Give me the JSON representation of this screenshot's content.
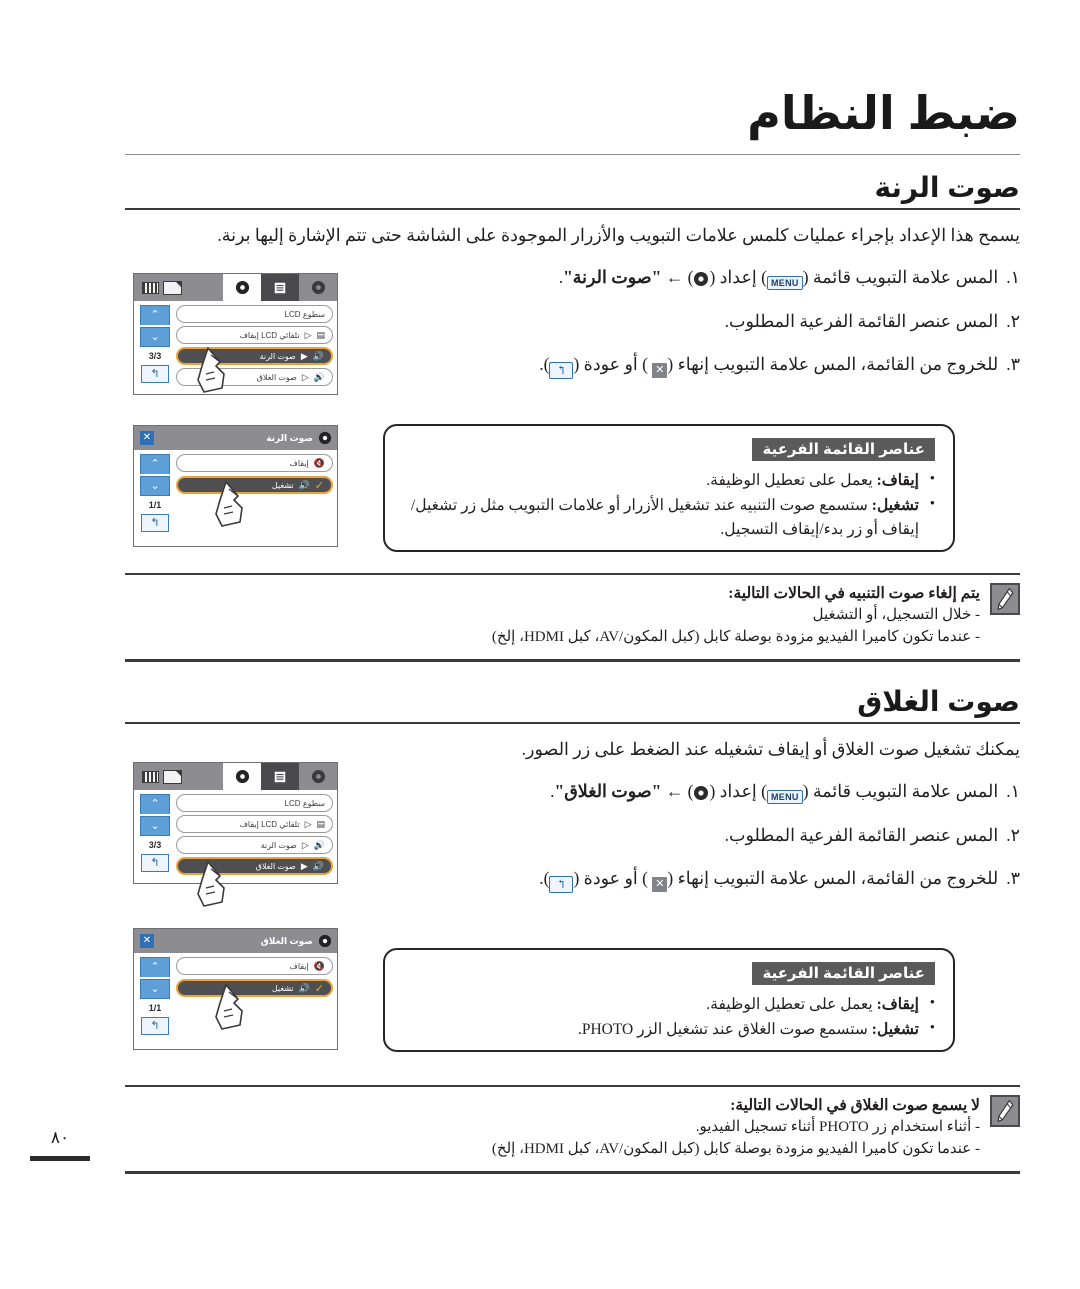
{
  "header": {
    "title": "ضبط النظام"
  },
  "folio": {
    "page_number": "٨٠"
  },
  "sections": [
    {
      "title": "صوت الرنة",
      "intro": "يسمح هذا الإعداد بإجراء عمليات كلمس علامات التبويب والأزرار الموجودة على الشاشة حتى تتم الإشارة إليها برنة.",
      "steps": [
        {
          "num": "١.",
          "before": "المس علامة التبويب قائمة (",
          "key1": "MENU",
          "mid": ") إعداد (",
          "mid2": ") ← ",
          "bold": "\"صوت الرنة\"",
          "after": "."
        },
        {
          "num": "٢.",
          "text": "المس عنصر القائمة الفرعية المطلوب."
        },
        {
          "num": "٣.",
          "before": "للخروج من القائمة، المس علامة التبويب إنهاء (",
          "mid": " ) أو عودة (",
          "after": ")."
        }
      ],
      "lcd_menu": {
        "page_indicator": "3/3",
        "rows": [
          {
            "label": "سطوع LCD",
            "icon": "",
            "selected": false
          },
          {
            "label": "تلقائي LCD إيقاف",
            "icon": "▷",
            "selected": false
          },
          {
            "label": "صوت الرنة",
            "icon": "▶",
            "selected": true
          },
          {
            "label": "صوت الغلاق",
            "icon": "▷",
            "selected": false
          }
        ]
      },
      "lcd_submenu": {
        "title": "صوت الرنة",
        "page_indicator": "1/1",
        "rows": [
          {
            "label": "إيقاف",
            "selected": false
          },
          {
            "label": "تشغيل",
            "selected": true
          }
        ]
      },
      "notebox": {
        "title": "عناصر القائمة الفرعية",
        "items": [
          {
            "bold": "إيقاف:",
            "text": " يعمل على تعطيل الوظيفة."
          },
          {
            "bold": "تشغيل:",
            "text": " ستسمع صوت التنبيه عند تشغيل الأزرار أو علامات التبويب مثل زر تشغيل/إيقاف أو زر بدء/إيقاف التسجيل."
          }
        ]
      },
      "warning": {
        "head": "يتم إلغاء صوت التنبيه في الحالات التالية:",
        "lines": [
          "- خلال التسجيل، أو التشغيل",
          "- عندما تكون كاميرا الفيديو مزودة بوصلة كابل (كبل المكون/AV، كبل HDMI، إلخ)"
        ]
      }
    },
    {
      "title": "صوت الغلاق",
      "intro": "يمكنك تشغيل صوت الغلاق أو إيقاف تشغيله عند الضغط على زر الصور.",
      "steps": [
        {
          "num": "١.",
          "before": "المس علامة التبويب قائمة (",
          "key1": "MENU",
          "mid": ") إعداد (",
          "mid2": ") ← ",
          "bold": "\"صوت الغلاق\"",
          "after": "."
        },
        {
          "num": "٢.",
          "text": "المس عنصر القائمة الفرعية المطلوب."
        },
        {
          "num": "٣.",
          "before": "للخروج من القائمة، المس علامة التبويب إنهاء (",
          "mid": " ) أو عودة (",
          "after": ")."
        }
      ],
      "lcd_menu": {
        "page_indicator": "3/3",
        "rows": [
          {
            "label": "سطوع LCD",
            "icon": "",
            "selected": false
          },
          {
            "label": "تلقائي LCD إيقاف",
            "icon": "▷",
            "selected": false
          },
          {
            "label": "صوت الرنة",
            "icon": "▷",
            "selected": false
          },
          {
            "label": "صوت الغلاق",
            "icon": "▶",
            "selected": true
          }
        ]
      },
      "lcd_submenu": {
        "title": "صوت الغلاق",
        "page_indicator": "1/1",
        "rows": [
          {
            "label": "إيقاف",
            "selected": false
          },
          {
            "label": "تشغيل",
            "selected": true
          }
        ]
      },
      "notebox": {
        "title": "عناصر القائمة الفرعية",
        "items": [
          {
            "bold": "إيقاف:",
            "text": " يعمل على تعطيل الوظيفة."
          },
          {
            "bold": "تشغيل:",
            "text": " ستسمع صوت الغلاق عند تشغيل الزر PHOTO."
          }
        ]
      },
      "warning": {
        "head": "لا يسمع صوت الغلاق في الحالات التالية:",
        "lines": [
          "- أثناء استخدام زر PHOTO أثناء تسجيل الفيديو.",
          "- عندما تكون كاميرا الفيديو مزودة بوصلة كابل (كبل المكون/AV، كبل HDMI، إلخ)"
        ]
      }
    }
  ],
  "icons": {
    "gear": "gear-icon",
    "menu_list": "menu-list-icon",
    "sd_card": "sd-card-icon",
    "battery": "battery-icon",
    "speaker": "speaker-icon",
    "arrow_up": "chevron-up-icon",
    "arrow_down": "chevron-down-icon",
    "back": "back-arrow-icon",
    "close": "close-icon",
    "check": "check-icon",
    "pencil_note": "pencil-note-icon",
    "hand_touch": "hand-touch-icon"
  },
  "colors": {
    "accent_orange": "#e8a33d",
    "accent_blue": "#5e9fd8",
    "tabbar_gray": "#8d8d91",
    "selected_row": "#4f4f52",
    "text": "#231f20"
  }
}
